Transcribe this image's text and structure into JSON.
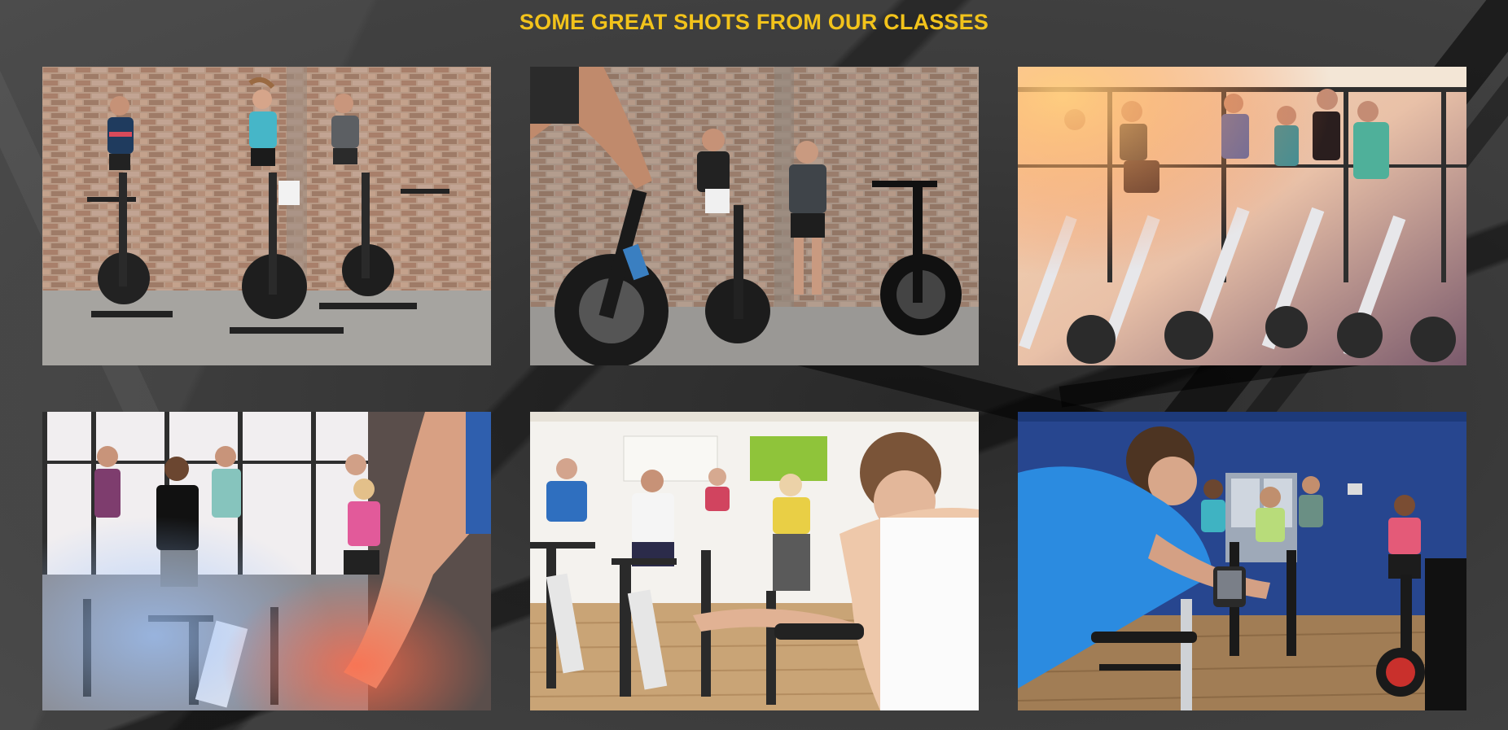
{
  "section": {
    "heading": "SOME GREAT SHOTS FROM OUR CLASSES"
  },
  "colors": {
    "heading": "#f2c31b",
    "background": "#3a3a3a"
  },
  "gallery": {
    "photos": [
      {
        "name": "photo-three-riders-brick-wall"
      },
      {
        "name": "photo-instructor-brick-wall"
      },
      {
        "name": "photo-women-class-sunlit"
      },
      {
        "name": "photo-group-class-windows"
      },
      {
        "name": "photo-instructor-foreground-class"
      },
      {
        "name": "photo-rider-blue-shirt-class"
      }
    ]
  }
}
